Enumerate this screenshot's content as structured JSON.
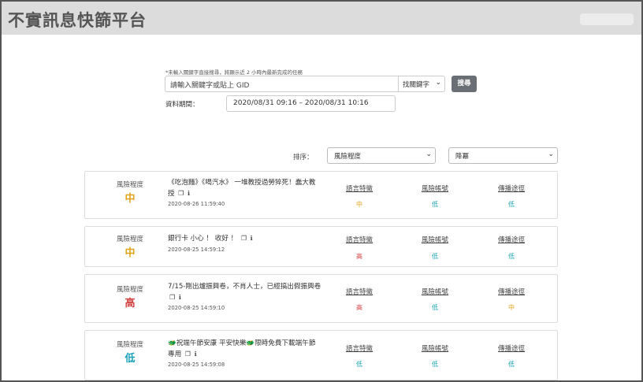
{
  "header": {
    "brand": "不實訊息快篩平台"
  },
  "search": {
    "hint": "*未輸入關鍵字直接搜尋，將顯示近 2 小時內最新完成的任務",
    "placeholder": "請輸入關鍵字或貼上 GID",
    "mode": "找關鍵字",
    "button": "搜尋",
    "period_label": "資料期間：",
    "period_value": "2020/08/31 09:16 – 2020/08/31 10:16"
  },
  "sort": {
    "label": "排序：",
    "field": "風險程度",
    "order": "降冪"
  },
  "colors": {
    "high": "#d04040",
    "mid": "#e2a21a",
    "low": "#17a2b8"
  },
  "columns": {
    "risk": "風險程度",
    "feature": "語言特徵",
    "account": "風險帳號",
    "path": "傳播途徑"
  },
  "items": [
    {
      "risk": "中",
      "title": "《吃泡麵》《喝汽水》 一堆教授過勞猝死！蠢大教授",
      "date": "2020-08-26 11:59:40",
      "feature": "中",
      "account": "低",
      "path": "低"
    },
    {
      "risk": "中",
      "title": "銀行卡 小心 ！ 收好 ！",
      "date": "2020-08-25 14:59:12",
      "feature": "高",
      "account": "低",
      "path": "低"
    },
    {
      "risk": "高",
      "title": "7/15-剛出爐振興卷，不肖人士，已經搞出假振興卷",
      "date": "2020-08-25 14:59:10",
      "feature": "高",
      "account": "低",
      "path": "中"
    },
    {
      "risk": "低",
      "title": "🐲祝端午節安康 平安快樂🐲限時免費下載端午節專用",
      "date": "2020-08-25 14:59:08",
      "feature": "低",
      "account": "低",
      "path": "低"
    }
  ]
}
